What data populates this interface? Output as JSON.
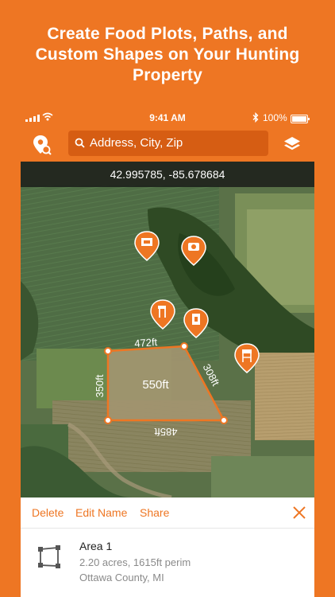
{
  "colors": {
    "brand": "#ee7623",
    "search_bg": "#d65d13"
  },
  "headline": {
    "line1": "Create Food Plots, Paths, and",
    "line2": "Custom Shapes on Your Hunting",
    "line3": "Property"
  },
  "status_bar": {
    "time": "9:41 AM",
    "battery": "100%"
  },
  "toolbar": {
    "left_icon": "map-pin-search-icon",
    "search_placeholder": "Address, City, Zip",
    "right_icon": "layers-icon"
  },
  "map": {
    "coordinates": "42.995785, -85.678684",
    "area_label": "550ft",
    "edge_top": "472ft",
    "edge_left": "350ft",
    "edge_right": "308ft",
    "edge_bottom": "485ft",
    "markers": [
      "hunting-blind-icon",
      "game-camera-icon",
      "tree-stand-icon",
      "feeder-icon",
      "ladder-stand-icon"
    ]
  },
  "sheet": {
    "actions": {
      "delete": "Delete",
      "edit_name": "Edit Name",
      "share": "Share"
    },
    "area": {
      "title": "Area 1",
      "stats": "2.20 acres, 1615ft perim",
      "location": "Ottawa County, MI"
    }
  }
}
